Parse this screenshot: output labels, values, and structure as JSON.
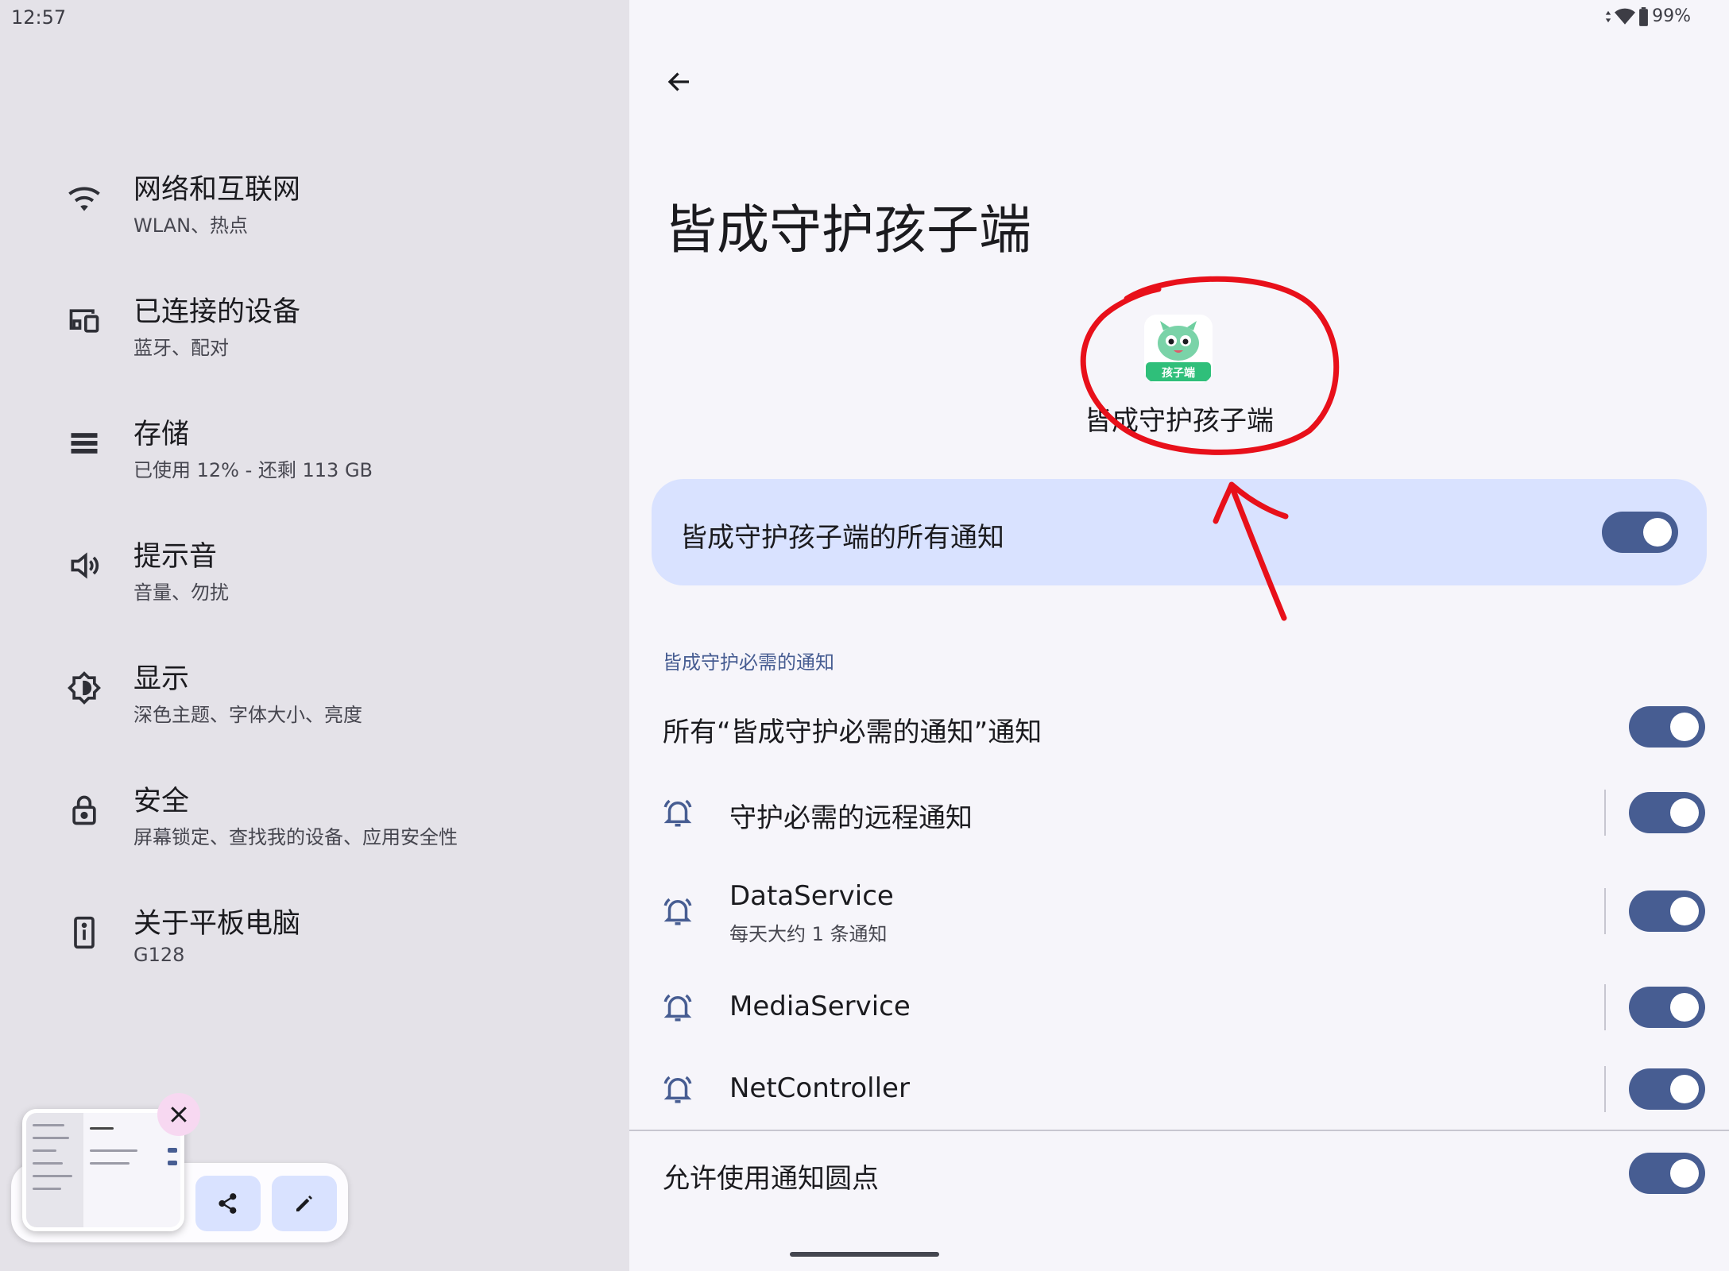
{
  "status_bar": {
    "time": "12:57",
    "battery": "99%"
  },
  "left_nav": {
    "items": [
      {
        "title": "网络和互联网",
        "subtitle": "WLAN、热点",
        "icon": "wifi-icon"
      },
      {
        "title": "已连接的设备",
        "subtitle": "蓝牙、配对",
        "icon": "devices-icon"
      },
      {
        "title": "存储",
        "subtitle": "已使用 12% - 还剩 113 GB",
        "icon": "storage-icon"
      },
      {
        "title": "提示音",
        "subtitle": "音量、勿扰",
        "icon": "volume-icon"
      },
      {
        "title": "显示",
        "subtitle": "深色主题、字体大小、亮度",
        "icon": "brightness-icon"
      },
      {
        "title": "安全",
        "subtitle": "屏幕锁定、查找我的设备、应用安全性",
        "icon": "lock-icon"
      },
      {
        "title": "关于平板电脑",
        "subtitle": "G128",
        "icon": "tablet-info-icon"
      }
    ]
  },
  "screenshot_preview": {
    "icons": [
      "close-icon",
      "share-icon",
      "edit-icon"
    ]
  },
  "detail": {
    "page_title": "皆成守护孩子端",
    "app_name": "皆成守护孩子端",
    "app_icon_badge": "孩子端",
    "master_toggle": {
      "label": "皆成守护孩子端的所有通知",
      "on": true
    },
    "section_title": "皆成守护必需的通知",
    "rows": [
      {
        "label": "所有“皆成守护必需的通知”通知",
        "subtitle": "",
        "on": true,
        "bell": false
      },
      {
        "label": "守护必需的远程通知",
        "subtitle": "",
        "on": true,
        "bell": true
      },
      {
        "label": "DataService",
        "subtitle": "每天大约 1 条通知",
        "on": true,
        "bell": true
      },
      {
        "label": "MediaService",
        "subtitle": "",
        "on": true,
        "bell": true
      },
      {
        "label": "NetController",
        "subtitle": "",
        "on": true,
        "bell": true
      }
    ],
    "dots_toggle": {
      "label": "允许使用通知圆点",
      "on": true
    }
  },
  "colors": {
    "accent": "#475d92",
    "highlight_card": "#d9e2ff",
    "annotation_red": "#e8101a",
    "left_pane_bg": "#e4e2e8",
    "right_pane_bg": "#f6f5fa"
  }
}
